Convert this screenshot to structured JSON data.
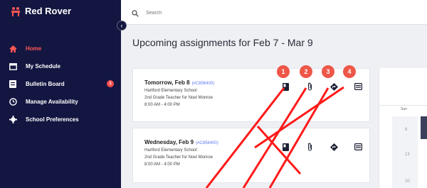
{
  "app": {
    "brand": "Red Rover"
  },
  "sidebar": {
    "items": [
      {
        "label": "Home",
        "icon": "home-icon",
        "active": true
      },
      {
        "label": "My Schedule",
        "icon": "calendar-icon",
        "active": false
      },
      {
        "label": "Bulletin Board",
        "icon": "bulletin-icon",
        "active": false,
        "badge": "1"
      },
      {
        "label": "Manage Availability",
        "icon": "clock-icon",
        "active": false
      },
      {
        "label": "School Preferences",
        "icon": "gear-icon",
        "active": false
      }
    ]
  },
  "search": {
    "placeholder": "Search"
  },
  "main": {
    "title": "Upcoming assignments for Feb 7 - Mar 9",
    "assignments": [
      {
        "date": "Tomorrow, Feb 8",
        "job": "(#C856400)",
        "school": "Hartford Elementary School",
        "role": "2nd Grade Teacher for Noel Monroe",
        "time": "8:00 AM - 4:00 PM"
      },
      {
        "date": "Wednesday, Feb 9",
        "job": "(#C856400)",
        "school": "Hartford Elementary School",
        "role": "2nd Grade Teacher for Noel Monroe",
        "time": "8:00 AM - 4:00 PM"
      }
    ],
    "action_icons": [
      "book-icon",
      "paperclip-icon",
      "directions-icon",
      "calendar-card-icon"
    ],
    "callouts": [
      "1",
      "2",
      "3",
      "4"
    ]
  },
  "calendar": {
    "day_label": "Sun",
    "dates": [
      "6",
      "13",
      "20"
    ]
  },
  "colors": {
    "sidebar": "#131640",
    "accent": "#ff5656",
    "callout": "#ee5648"
  }
}
